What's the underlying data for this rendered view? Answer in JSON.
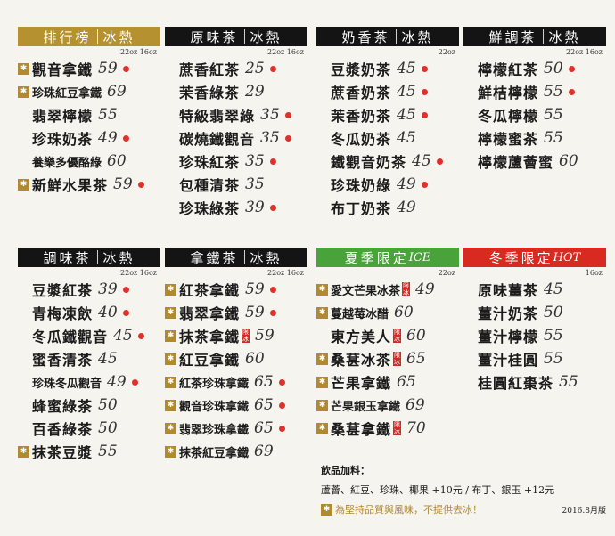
{
  "mark_glyph": "✱",
  "sections": [
    {
      "id": "ranking",
      "title": "排行榜",
      "sub": "冰熱",
      "color": "gold",
      "sizes": "22oz 16oz",
      "items": [
        {
          "mark": true,
          "name": "觀音拿鐵",
          "price": "59",
          "dot": true
        },
        {
          "mark": true,
          "name": "珍珠紅豆拿鐵",
          "price": "69",
          "small": true
        },
        {
          "name": "翡翠檸檬",
          "price": "55"
        },
        {
          "name": "珍珠奶茶",
          "price": "49",
          "dot": true
        },
        {
          "name": "養樂多優酪綠",
          "price": "60",
          "small": true
        },
        {
          "mark": true,
          "name": "新鮮水果茶",
          "price": "59",
          "dot": true
        }
      ]
    },
    {
      "id": "original",
      "title": "原味茶",
      "sub": "冰熱",
      "color": "black",
      "sizes": "22oz 16oz",
      "items": [
        {
          "name": "蔗香紅茶",
          "price": "25",
          "dot": true
        },
        {
          "name": "茉香綠茶",
          "price": "29"
        },
        {
          "name": "特級翡翠綠",
          "price": "35",
          "dot": true
        },
        {
          "name": "碳燒鐵觀音",
          "price": "35",
          "dot": true
        },
        {
          "name": "珍珠紅茶",
          "price": "35",
          "dot": true
        },
        {
          "name": "包種清茶",
          "price": "35"
        },
        {
          "name": "珍珠綠茶",
          "price": "39",
          "dot": true
        }
      ]
    },
    {
      "id": "milk",
      "title": "奶香茶",
      "sub": "冰熱",
      "color": "black",
      "sizes": "22oz",
      "items": [
        {
          "name": "豆漿奶茶",
          "price": "45",
          "dot": true
        },
        {
          "name": "蔗香奶茶",
          "price": "45",
          "dot": true
        },
        {
          "name": "茉香奶茶",
          "price": "45",
          "dot": true
        },
        {
          "name": "冬瓜奶茶",
          "price": "45"
        },
        {
          "name": "鐵觀音奶茶",
          "price": "45",
          "dot": true
        },
        {
          "name": "珍珠奶綠",
          "price": "49",
          "dot": true
        },
        {
          "name": "布丁奶茶",
          "price": "49"
        }
      ]
    },
    {
      "id": "fresh",
      "title": "鮮調茶",
      "sub": "冰熱",
      "color": "black",
      "sizes": "22oz 16oz",
      "items": [
        {
          "name": "檸檬紅茶",
          "price": "50",
          "dot": true
        },
        {
          "name": "鮮桔檸檬",
          "price": "55",
          "dot": true
        },
        {
          "name": "冬瓜檸檬",
          "price": "55"
        },
        {
          "name": "檸檬蜜茶",
          "price": "55"
        },
        {
          "name": "檸檬蘆薈蜜",
          "price": "60"
        }
      ]
    },
    {
      "id": "flavor",
      "title": "調味茶",
      "sub": "冰熱",
      "color": "black",
      "sizes": "22oz 16oz",
      "items": [
        {
          "name": "豆漿紅茶",
          "price": "39",
          "dot": true
        },
        {
          "name": "青梅凍飲",
          "price": "40",
          "dot": true
        },
        {
          "name": "冬瓜鐵觀音",
          "price": "45",
          "dot": true
        },
        {
          "name": "蜜香清茶",
          "price": "45"
        },
        {
          "name": "珍珠冬瓜觀音",
          "price": "49",
          "dot": true,
          "small": true
        },
        {
          "name": "蜂蜜綠茶",
          "price": "50"
        },
        {
          "name": "百香綠茶",
          "price": "50"
        },
        {
          "mark": true,
          "name": "抹茶豆漿",
          "price": "55"
        }
      ]
    },
    {
      "id": "latte",
      "title": "拿鐵茶",
      "sub": "冰熱",
      "color": "black",
      "sizes": "22oz 16oz",
      "items": [
        {
          "mark": true,
          "name": "紅茶拿鐵",
          "price": "59",
          "dot": true
        },
        {
          "mark": true,
          "name": "翡翠拿鐵",
          "price": "59",
          "dot": true
        },
        {
          "mark": true,
          "name": "抹茶拿鐵",
          "price": "59",
          "tag": "限冰"
        },
        {
          "mark": true,
          "name": "紅豆拿鐵",
          "price": "60"
        },
        {
          "mark": true,
          "name": "紅茶珍珠拿鐵",
          "price": "65",
          "dot": true,
          "small": true
        },
        {
          "mark": true,
          "name": "觀音珍珠拿鐵",
          "price": "65",
          "dot": true,
          "small": true
        },
        {
          "mark": true,
          "name": "翡翠珍珠拿鐵",
          "price": "65",
          "dot": true,
          "small": true
        },
        {
          "mark": true,
          "name": "抹茶紅豆拿鐵",
          "price": "69",
          "small": true
        }
      ]
    },
    {
      "id": "summer",
      "title": "夏季限定",
      "sub": "ICE",
      "color": "green",
      "sizes": "22oz",
      "items": [
        {
          "mark": true,
          "name": "愛文芒果冰茶",
          "price": "49",
          "tag": "限冰",
          "small": true
        },
        {
          "mark": true,
          "name": "蔓越莓冰醋",
          "price": "60",
          "small": true
        },
        {
          "name": "東方美人",
          "price": "60",
          "tag": "限冰"
        },
        {
          "mark": true,
          "name": "桑葚冰茶",
          "price": "65",
          "tag": "限冰"
        },
        {
          "mark": true,
          "name": "芒果拿鐵",
          "price": "65"
        },
        {
          "mark": true,
          "name": "芒果銀玉拿鐵",
          "price": "69",
          "small": true
        },
        {
          "mark": true,
          "name": "桑葚拿鐵",
          "price": "70",
          "tag": "限冰"
        }
      ]
    },
    {
      "id": "winter",
      "title": "冬季限定",
      "sub": "HOT",
      "color": "red",
      "sizes": "16oz",
      "items": [
        {
          "name": "原味薑茶",
          "price": "45"
        },
        {
          "name": "薑汁奶茶",
          "price": "50"
        },
        {
          "name": "薑汁檸檬",
          "price": "55"
        },
        {
          "name": "薑汁桂圓",
          "price": "55"
        },
        {
          "name": "桂圓紅棗茶",
          "price": "55"
        }
      ]
    }
  ],
  "addon": {
    "title": "飲品加料：",
    "line": "蘆薈、紅豆、珍珠、椰果 +10元 / 布丁、銀玉 +12元",
    "note": "為堅持品質與風味，不提供去冰！",
    "date": "2016.8月版"
  }
}
